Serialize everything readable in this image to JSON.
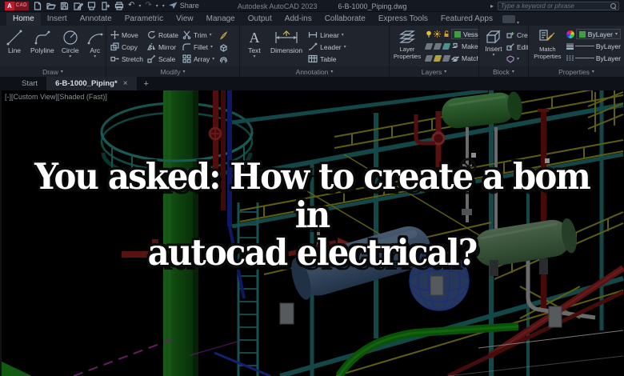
{
  "window": {
    "title_product": "Autodesk AutoCAD 2023",
    "title_file": "6-B-1000_Piping.dwg",
    "share_label": "Share",
    "search_placeholder": "Type a keyword or phrase"
  },
  "icons": {
    "undo": "↶",
    "redo": "↷",
    "dropdown": "▾",
    "chevron": "▸",
    "close": "×",
    "new_tab": "+"
  },
  "ribbon": {
    "tabs": [
      "Home",
      "Insert",
      "Annotate",
      "Parametric",
      "View",
      "Manage",
      "Output",
      "Add-ins",
      "Collaborate",
      "Express Tools",
      "Featured Apps"
    ],
    "active_tab": "Home",
    "panels": {
      "draw": {
        "label": "Draw",
        "items": [
          "Line",
          "Polyline",
          "Circle",
          "Arc"
        ]
      },
      "modify": {
        "label": "Modify",
        "col1": [
          "Move",
          "Copy",
          "Stretch"
        ],
        "col2": [
          "Rotate",
          "Mirror",
          "Scale"
        ],
        "col3": [
          "Trim",
          "Fillet",
          "Array"
        ]
      },
      "annotation": {
        "label": "Annotation",
        "big": [
          "Text",
          "Dimension"
        ],
        "col": [
          "Linear",
          "Leader",
          "Table"
        ]
      },
      "layers": {
        "label": "Layers",
        "big_button": "Layer Properties",
        "current_layer": "Vessels",
        "make_current": "Make Current",
        "match_layer": "Match Layer",
        "layer_swatch_color": "#3f9e3f"
      },
      "block": {
        "label": "Block",
        "big_button": "Insert",
        "col": [
          "Create",
          "Edit"
        ]
      },
      "properties": {
        "label": "Properties",
        "big_button": "Match Properties",
        "color_value": "ByLayer",
        "lineweight_value": "ByLayer",
        "linetype_value": "ByLayer",
        "bylayer_swatch_color": "#3f9e3f"
      }
    }
  },
  "file_tabs": {
    "start": "Start",
    "active": "6-B-1000_Piping*"
  },
  "viewport": {
    "label": "[-][Custom View][Shaded (Fast)]"
  },
  "overlay": {
    "line1": "You asked: How to create a bom in",
    "line2": "autocad electrical?",
    "text_color": "#ffffff",
    "outline_color": "#0a0a0a"
  },
  "palette": {
    "ui_titlebar": "#141821",
    "ui_ribbon": "#1f242d",
    "autocad_red": "#c21b2f",
    "column_green": "#1e8a1e",
    "structure_teal": "#2a8f88",
    "rail_yellow": "#aaaa20",
    "pipe_red": "#a02020",
    "pipe_blue": "#2233c8",
    "pipe_green": "#17a017",
    "vessel_steelblue": "#5c82a8",
    "vessel_green": "#46a046",
    "vessel_olive": "#6a9e6a"
  }
}
